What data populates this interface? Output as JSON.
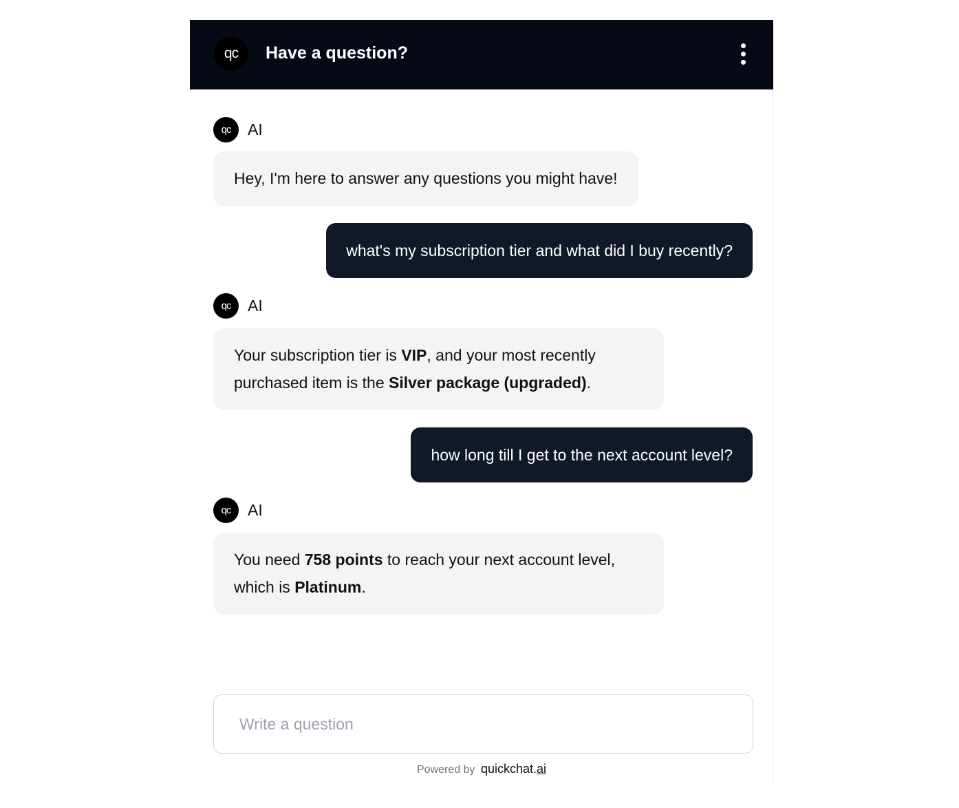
{
  "header": {
    "logo_text": "qc",
    "title": "Have a question?",
    "menu_icon": "vertical-dots-icon"
  },
  "messages": [
    {
      "role": "ai",
      "avatar_text": "qc",
      "sender": "AI",
      "parts": [
        {
          "text": "Hey, I'm here to answer any questions you might have!",
          "bold": false
        }
      ]
    },
    {
      "role": "user",
      "text": "what's my subscription tier and what did I buy recently?"
    },
    {
      "role": "ai",
      "avatar_text": "qc",
      "sender": "AI",
      "parts": [
        {
          "text": "Your subscription tier is ",
          "bold": false
        },
        {
          "text": "VIP",
          "bold": true
        },
        {
          "text": ", and your most recently purchased item is the ",
          "bold": false
        },
        {
          "text": "Silver package (upgraded)",
          "bold": true
        },
        {
          "text": ".",
          "bold": false
        }
      ]
    },
    {
      "role": "user",
      "text": "how long till I get to the next account level?"
    },
    {
      "role": "ai",
      "avatar_text": "qc",
      "sender": "AI",
      "parts": [
        {
          "text": "You need ",
          "bold": false
        },
        {
          "text": "758 points",
          "bold": true
        },
        {
          "text": " to reach your next account level, which is ",
          "bold": false
        },
        {
          "text": "Platinum",
          "bold": true
        },
        {
          "text": ".",
          "bold": false
        }
      ]
    }
  ],
  "input": {
    "placeholder": "Write a question",
    "value": ""
  },
  "footer": {
    "powered_by": "Powered by",
    "brand_main": "quickchat.",
    "brand_suffix": "ai"
  }
}
